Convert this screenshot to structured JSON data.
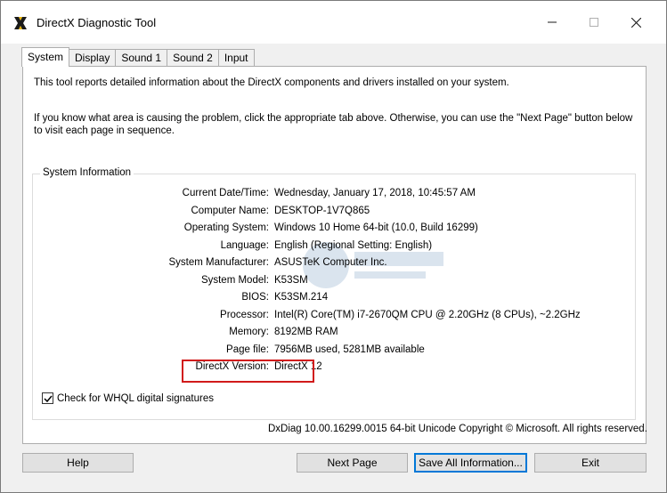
{
  "window": {
    "title": "DirectX Diagnostic Tool"
  },
  "tabs": [
    {
      "label": "System",
      "active": true
    },
    {
      "label": "Display",
      "active": false
    },
    {
      "label": "Sound 1",
      "active": false
    },
    {
      "label": "Sound 2",
      "active": false
    },
    {
      "label": "Input",
      "active": false
    }
  ],
  "intro": {
    "line1": "This tool reports detailed information about the DirectX components and drivers installed on your system.",
    "line2": "If you know what area is causing the problem, click the appropriate tab above.  Otherwise, you can use the \"Next Page\" button below to visit each page in sequence."
  },
  "system_info": {
    "group_title": "System Information",
    "rows": [
      {
        "label": "Current Date/Time:",
        "value": "Wednesday, January 17, 2018, 10:45:57 AM"
      },
      {
        "label": "Computer Name:",
        "value": "DESKTOP-1V7Q865"
      },
      {
        "label": "Operating System:",
        "value": "Windows 10 Home 64-bit (10.0, Build 16299)"
      },
      {
        "label": "Language:",
        "value": "English (Regional Setting: English)"
      },
      {
        "label": "System Manufacturer:",
        "value": "ASUSTeK Computer Inc."
      },
      {
        "label": "System Model:",
        "value": "K53SM"
      },
      {
        "label": "BIOS:",
        "value": "K53SM.214"
      },
      {
        "label": "Processor:",
        "value": "Intel(R) Core(TM) i7-2670QM CPU @ 2.20GHz (8 CPUs), ~2.2GHz"
      },
      {
        "label": "Memory:",
        "value": "8192MB RAM"
      },
      {
        "label": "Page file:",
        "value": "7956MB used, 5281MB available"
      },
      {
        "label": "DirectX Version:",
        "value": "DirectX 12"
      }
    ]
  },
  "whql_checkbox": {
    "label": "Check for WHQL digital signatures",
    "checked": true
  },
  "status_line": "DxDiag 10.00.16299.0015 64-bit Unicode  Copyright © Microsoft. All rights reserved.",
  "buttons": {
    "help": "Help",
    "next_page": "Next Page",
    "save_all": "Save All Information...",
    "exit": "Exit"
  },
  "colors": {
    "highlight_border": "#d11a1a",
    "focus_border": "#0078d7"
  }
}
